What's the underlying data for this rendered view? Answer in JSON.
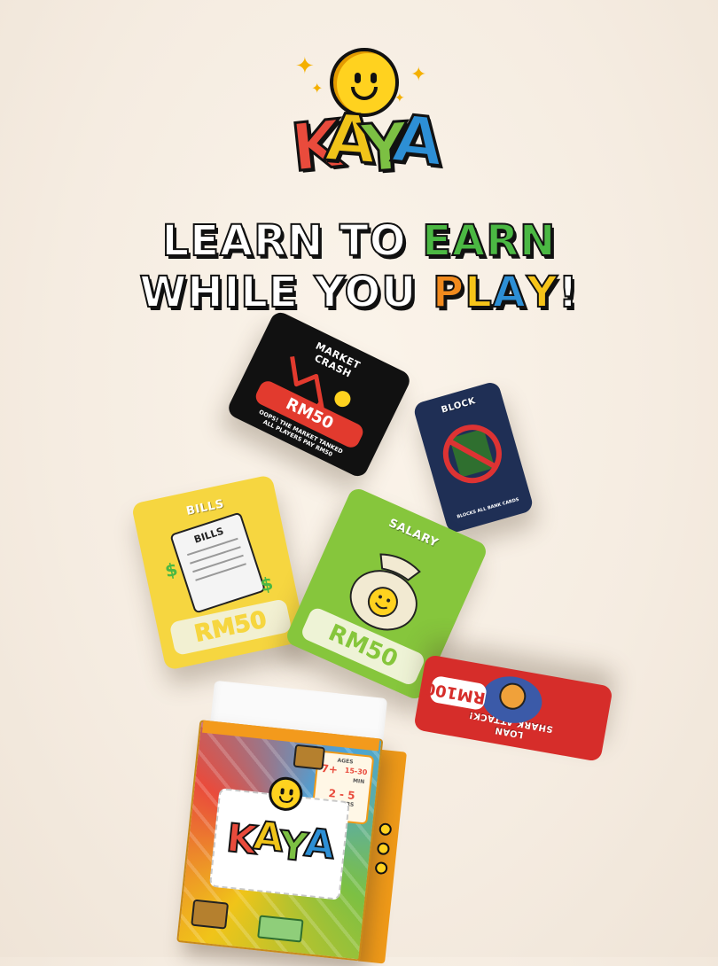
{
  "logo": {
    "letters": [
      "K",
      "A",
      "Y",
      "A"
    ],
    "colors": [
      "#e94b3c",
      "#f0c419",
      "#7cc043",
      "#2d8fd5"
    ]
  },
  "headline": {
    "line1_white": "LEARN TO ",
    "line1_accent": "EARN",
    "line2_white": "WHILE YOU ",
    "line2_p": "P",
    "line2_l": "L",
    "line2_a": "A",
    "line2_y": "Y",
    "line2_end": "!",
    "accent_green": "#4bb843",
    "p_orange": "#f18a1d",
    "l_yellow": "#f6c419",
    "a_blue": "#2d8fd5",
    "y_yellow": "#f6c419"
  },
  "cards": {
    "market_crash": {
      "title_line1": "MARKET",
      "title_line2": "CRASH",
      "amount": "RM50",
      "note_line1": "OOPS! THE MARKET TANKED",
      "note_line2": "ALL PLAYERS PAY RM50",
      "color": "#111111"
    },
    "block": {
      "title": "BLOCK",
      "note": "BLOCKS ALL BANK CARDS",
      "color": "#1f2f55"
    },
    "bills": {
      "title": "BILLS",
      "paper_text": "BILLS",
      "amount": "RM50",
      "color": "#f6d640"
    },
    "salary": {
      "title": "SALARY",
      "amount": "RM50",
      "color": "#86c63c"
    },
    "loan": {
      "title_line1": "LOAN",
      "title_line2": "SHARK ATTACK!",
      "amount": "RM100",
      "color": "#d62d2a"
    }
  },
  "box": {
    "age_label": "AGES",
    "age_value": "7+",
    "time_value": "15-30",
    "time_unit": "MIN",
    "players_value": "2 - 5",
    "players_label": "PLAYERS",
    "logo_letters": [
      "K",
      "A",
      "Y",
      "A"
    ]
  }
}
